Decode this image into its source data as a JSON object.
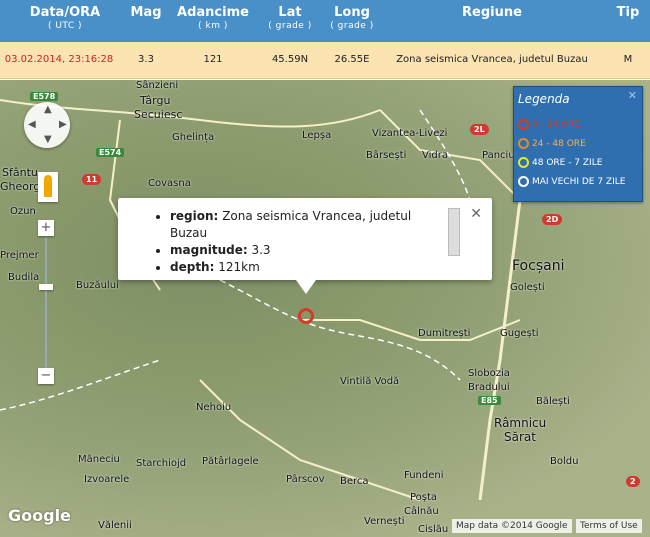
{
  "header": {
    "columns": [
      {
        "title": "Data/ORA",
        "unit": "( UTC )"
      },
      {
        "title": "Mag",
        "unit": ""
      },
      {
        "title": "Adancime",
        "unit": "( km )"
      },
      {
        "title": "Lat",
        "unit": "( grade )"
      },
      {
        "title": "Long",
        "unit": "( grade )"
      },
      {
        "title": "Regiune",
        "unit": ""
      },
      {
        "title": "Tip",
        "unit": ""
      }
    ]
  },
  "event": {
    "datetime": "03.02.2014, 23:16:28",
    "mag": "3.3",
    "depth": "121",
    "lat": "45.59N",
    "long": "26.55E",
    "region": "Zona seismica Vrancea, judetul Buzau",
    "type": "M"
  },
  "popup": {
    "region_label": "region:",
    "region_value": "Zona seismica Vrancea, judetul Buzau",
    "magnitude_label": "magnitude:",
    "magnitude_value": "3.3",
    "depth_label": "depth:",
    "depth_value": "121km"
  },
  "legend": {
    "title": "Legenda",
    "items": [
      {
        "label": "0 - 24 ORE",
        "color": "#d43b2b"
      },
      {
        "label": "24 - 48 ORE",
        "color": "#e08a2a"
      },
      {
        "label": "48 ORE - 7 ZILE",
        "color": "#e6e62a"
      },
      {
        "label": "MAI VECHI DE 7 ZILE",
        "color": "#ffffff"
      }
    ]
  },
  "map_labels": {
    "sanzieni": "Sânzieni",
    "targu": "Târgu",
    "secuiesc": "Secuiesc",
    "ghelinta": "Ghelința",
    "lepsa": "Lepșa",
    "vizantea": "Vizantea-Livezi",
    "barsesti": "Bârsești",
    "vidra": "Vidra",
    "panciu": "Panciu",
    "sfantu": "Sfântu",
    "gheorghe": "Gheorg",
    "covasna": "Covasna",
    "ozun": "Ozun",
    "prejmer": "Prejmer",
    "budila": "Budila",
    "buzaului": "Buzăului",
    "focsani": "Focșani",
    "golesti": "Golești",
    "dumitresti": "Dumitrești",
    "gugesti": "Gugești",
    "slobozia": "Slobozia",
    "bradului": "Bradului",
    "vintila": "Vintilă Vodă",
    "nehoiu": "Nehoiu",
    "balesti": "Bălești",
    "ramnicu": "Râmnicu",
    "sarat": "Sărat",
    "manecu": "Măneciu",
    "izvoarele": "Izvoarele",
    "starchiojd": "Starchiojd",
    "patarlagele": "Pătârlagele",
    "parscov": "Pârscov",
    "berca": "Berca",
    "fundeni": "Fundeni",
    "posta": "Poșta",
    "calnau": "Câlnău",
    "boldu": "Boldu",
    "valenii": "Vălenii",
    "vernesti": "Vernești",
    "cislau": "Cislău"
  },
  "road_badges": {
    "e578": "E578",
    "e574": "E574",
    "r11": "11",
    "r2l": "2L",
    "r2d": "2D",
    "e85": "E85",
    "r2": "2"
  },
  "attribution": {
    "google": "Google",
    "map_data": "Map data ©2014 Google",
    "terms": "Terms of Use"
  }
}
